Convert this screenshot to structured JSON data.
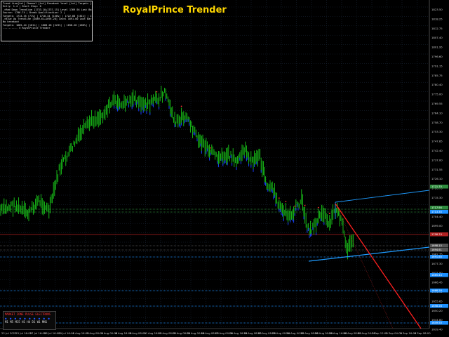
{
  "brand": {
    "title": "RoyalPrince Trender",
    "color": "#ffd700"
  },
  "info_panel": {
    "lines": [
      "Trend Line[txt] Channel [txt]  Breakout level [txt]  Targets [txt]",
      "Entry: 1.4 | Short Stop: 0",
      "->Red Down Trendline [1733.10+1737.15]  Level 1769.94  Last Bar  | Break Qualification: 1 |",
      "Source: 1706.74 | Break Qualification: 2 |",
      "Targets: 1713.35 [71%] | 1718.34 [150%] | 1722.68 [161%] | 1750.00 [223%] |",
      "->Blue Up Trendline [1689.61+1695.28]  Level 1691.60  Last Bar  | Break Qualification: 1 |",
      "No breakout",
      "Targets: 1685.44 [161%] | 1668.28 [223%] | 1658.28 [200%] | 1649.50 [224%] |",
      "---------- © RoyalPrince Trender"
    ]
  },
  "legend": {
    "title": "MARKET ZONE  PULSE  ELECTRONS",
    "dots": "● ● ● ● ● ● ● ● ● ●",
    "timeframes": "M1  M5  M15  H1  H4  D1  W1  MN1"
  },
  "x_axis": {
    "labels": [
      "22 Jul 2022",
      "25 Jul 16:00",
      "27 Jul 16:00",
      "28 Jul 16:00",
      "29 Jul 16:00",
      "1 Aug 16:00",
      "3 Aug 08:00",
      "5 Aug 00:00",
      "8 Aug 16:00",
      "9 Aug 08:00",
      "10 Aug 16:00",
      "11 Aug 08:00",
      "12 Aug 08:00",
      "15 Aug 00:00",
      "16 Aug 08:00",
      "17 Aug 00:00",
      "18 Aug 16:00",
      "19 Aug 08:00",
      "22 Aug 08:00",
      "23 Aug 00:00",
      "24 Aug 00:00",
      "25 Aug 08:00",
      "26 Aug 00:00",
      "29 Aug 16:00",
      "30 Aug 08:00",
      "31 Aug 00:00",
      "1 Sep 12:00",
      "2 Sep 04:00",
      "5 Sep 16:00",
      "6 Sep 08:00"
    ]
  },
  "y_axis": {
    "labels": [
      "1823.50",
      "1818.25",
      "1812.75",
      "1807.40",
      "1801.95",
      "1796.60",
      "1791.15",
      "1785.75",
      "1780.40",
      "1775.00",
      "1769.55",
      "1764.10",
      "1758.70",
      "1753.30",
      "1747.85",
      "1742.40",
      "1737.00",
      "1731.55",
      "1726.10",
      "1720.75",
      "1715.30",
      "1709.85",
      "1704.40",
      "1699.00",
      "1693.60",
      "1688.15",
      "1682.75",
      "1677.30",
      "1671.90",
      "1666.45",
      "1661.05",
      "1655.65",
      "1650.20",
      "1644.80",
      "1639.40"
    ]
  },
  "price_tags": [
    {
      "value": "1721.70",
      "color": "#2e8b3d"
    },
    {
      "value": "1717.90",
      "color": "#2e8b3d"
    },
    {
      "value": "1713.35",
      "color": "#1e90ff"
    },
    {
      "value": "1706.74",
      "color": "#b22222"
    },
    {
      "value": "1698.15",
      "color": "#555555"
    },
    {
      "value": "1694.61",
      "color": "#555555"
    },
    {
      "value": "1691.60",
      "color": "#1e90ff"
    },
    {
      "value": "1685.44",
      "color": "#1e90ff"
    },
    {
      "value": "1668.28",
      "color": "#1e90ff"
    },
    {
      "value": "1658.28",
      "color": "#1e90ff"
    },
    {
      "value": "1649.50",
      "color": "#1e90ff"
    }
  ],
  "colors": {
    "candle_up": "#19c819",
    "candle_body_low": "#1a3cff",
    "spike": "#ff3030",
    "red_trend": "#ff2020",
    "blue_trend": "#1e9bff",
    "grid": "#1c2a3c"
  }
}
